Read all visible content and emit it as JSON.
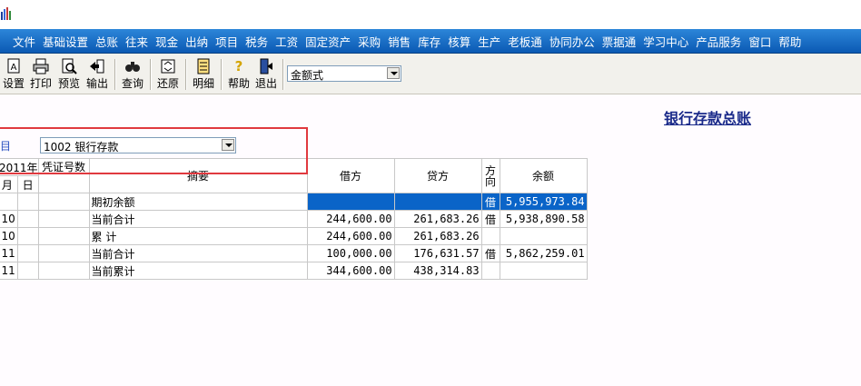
{
  "window": {
    "title": ""
  },
  "menu": [
    "文件",
    "基础设置",
    "总账",
    "往来",
    "现金",
    "出纳",
    "项目",
    "税务",
    "工资",
    "固定资产",
    "采购",
    "销售",
    "库存",
    "核算",
    "生产",
    "老板通",
    "协同办公",
    "票据通",
    "学习中心",
    "产品服务",
    "窗口",
    "帮助"
  ],
  "toolbar": {
    "buttons": [
      {
        "label": "设置",
        "icon": "settings-icon"
      },
      {
        "label": "打印",
        "icon": "printer-icon"
      },
      {
        "label": "预览",
        "icon": "preview-icon"
      },
      {
        "label": "输出",
        "icon": "export-icon"
      },
      {
        "label": "查询",
        "icon": "binoculars-icon"
      },
      {
        "label": "还原",
        "icon": "restore-icon"
      },
      {
        "label": "明细",
        "icon": "detail-icon"
      },
      {
        "label": "帮助",
        "icon": "help-icon"
      },
      {
        "label": "退出",
        "icon": "exit-icon"
      }
    ],
    "format_select": "金额式"
  },
  "report": {
    "title": "银行存款总账",
    "account_label": "科目",
    "account_value": "1002 银行存款"
  },
  "table": {
    "headers": {
      "year": "2011年",
      "month": "月",
      "day": "日",
      "voucher": "凭证号数",
      "summary": "摘要",
      "debit": "借方",
      "credit": "贷方",
      "direction": "方向",
      "balance": "余额"
    },
    "rows": [
      {
        "month": "",
        "day": "",
        "voucher": "",
        "summary": "期初余额",
        "debit": "",
        "credit": "",
        "direction": "借",
        "balance": "5,955,973.84"
      },
      {
        "month": "10",
        "day": "",
        "voucher": "",
        "summary": "当前合计",
        "debit": "244,600.00",
        "credit": "261,683.26",
        "direction": "借",
        "balance": "5,938,890.58"
      },
      {
        "month": "10",
        "day": "",
        "voucher": "",
        "summary": "累    计",
        "debit": "244,600.00",
        "credit": "261,683.26",
        "direction": "",
        "balance": ""
      },
      {
        "month": "11",
        "day": "",
        "voucher": "",
        "summary": "当前合计",
        "debit": "100,000.00",
        "credit": "176,631.57",
        "direction": "借",
        "balance": "5,862,259.01"
      },
      {
        "month": "11",
        "day": "",
        "voucher": "",
        "summary": "当前累计",
        "debit": "344,600.00",
        "credit": "438,314.83",
        "direction": "",
        "balance": ""
      }
    ]
  }
}
